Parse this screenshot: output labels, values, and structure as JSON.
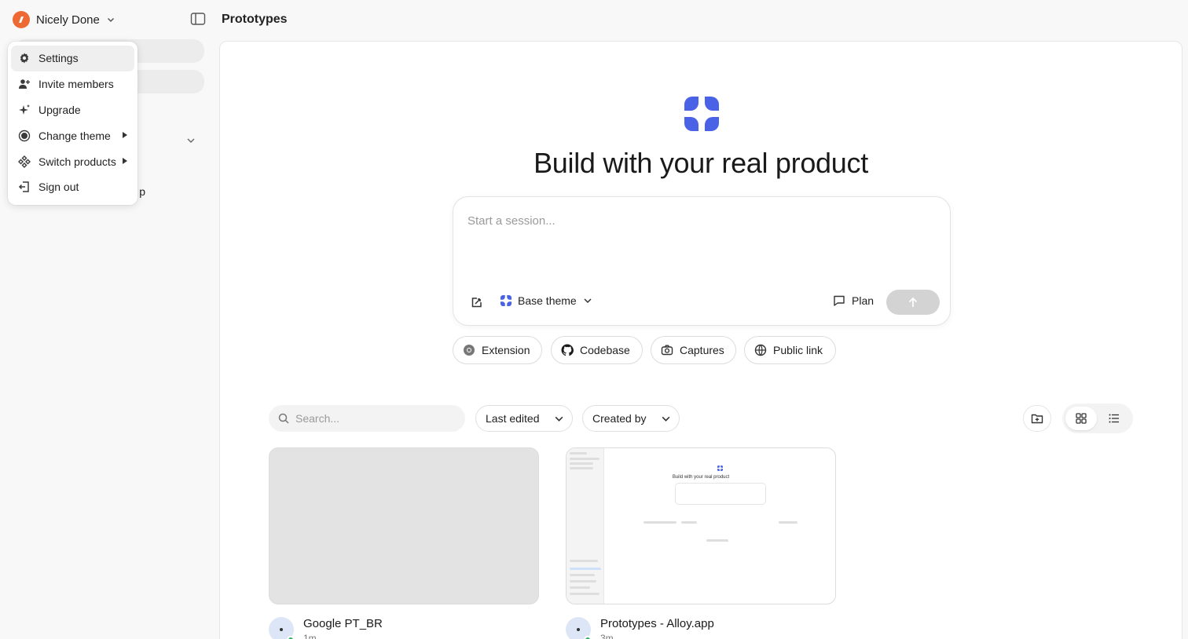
{
  "workspace": {
    "name": "Nicely Done",
    "logo_color": "#ee6a34"
  },
  "sidebar": {
    "partial_item_text": "p"
  },
  "menu": {
    "items": [
      {
        "label": "Settings",
        "icon": "gear-icon"
      },
      {
        "label": "Invite members",
        "icon": "invite-member-icon"
      },
      {
        "label": "Upgrade",
        "icon": "sparkle-icon"
      },
      {
        "label": "Change theme",
        "icon": "theme-icon",
        "submenu": true
      },
      {
        "label": "Switch products",
        "icon": "grid-diamond-icon",
        "submenu": true
      },
      {
        "label": "Sign out",
        "icon": "sign-out-icon"
      }
    ]
  },
  "header": {
    "title": "Prototypes"
  },
  "hero": {
    "title": "Build with your real product",
    "brand_color": "#4a63e6"
  },
  "composer": {
    "placeholder": "Start a session...",
    "theme_label": "Base theme",
    "plan_label": "Plan"
  },
  "chips": [
    {
      "label": "Extension",
      "icon": "chrome-icon"
    },
    {
      "label": "Codebase",
      "icon": "github-icon"
    },
    {
      "label": "Captures",
      "icon": "camera-icon"
    },
    {
      "label": "Public link",
      "icon": "globe-icon"
    }
  ],
  "toolbar": {
    "search_placeholder": "Search...",
    "sort_label": "Last edited",
    "filter_label": "Created by"
  },
  "cards": [
    {
      "title": "Google PT_BR",
      "time": "1m"
    },
    {
      "title": "Prototypes - Alloy.app",
      "time": "3m",
      "preview_title": "Build with your real product"
    }
  ]
}
